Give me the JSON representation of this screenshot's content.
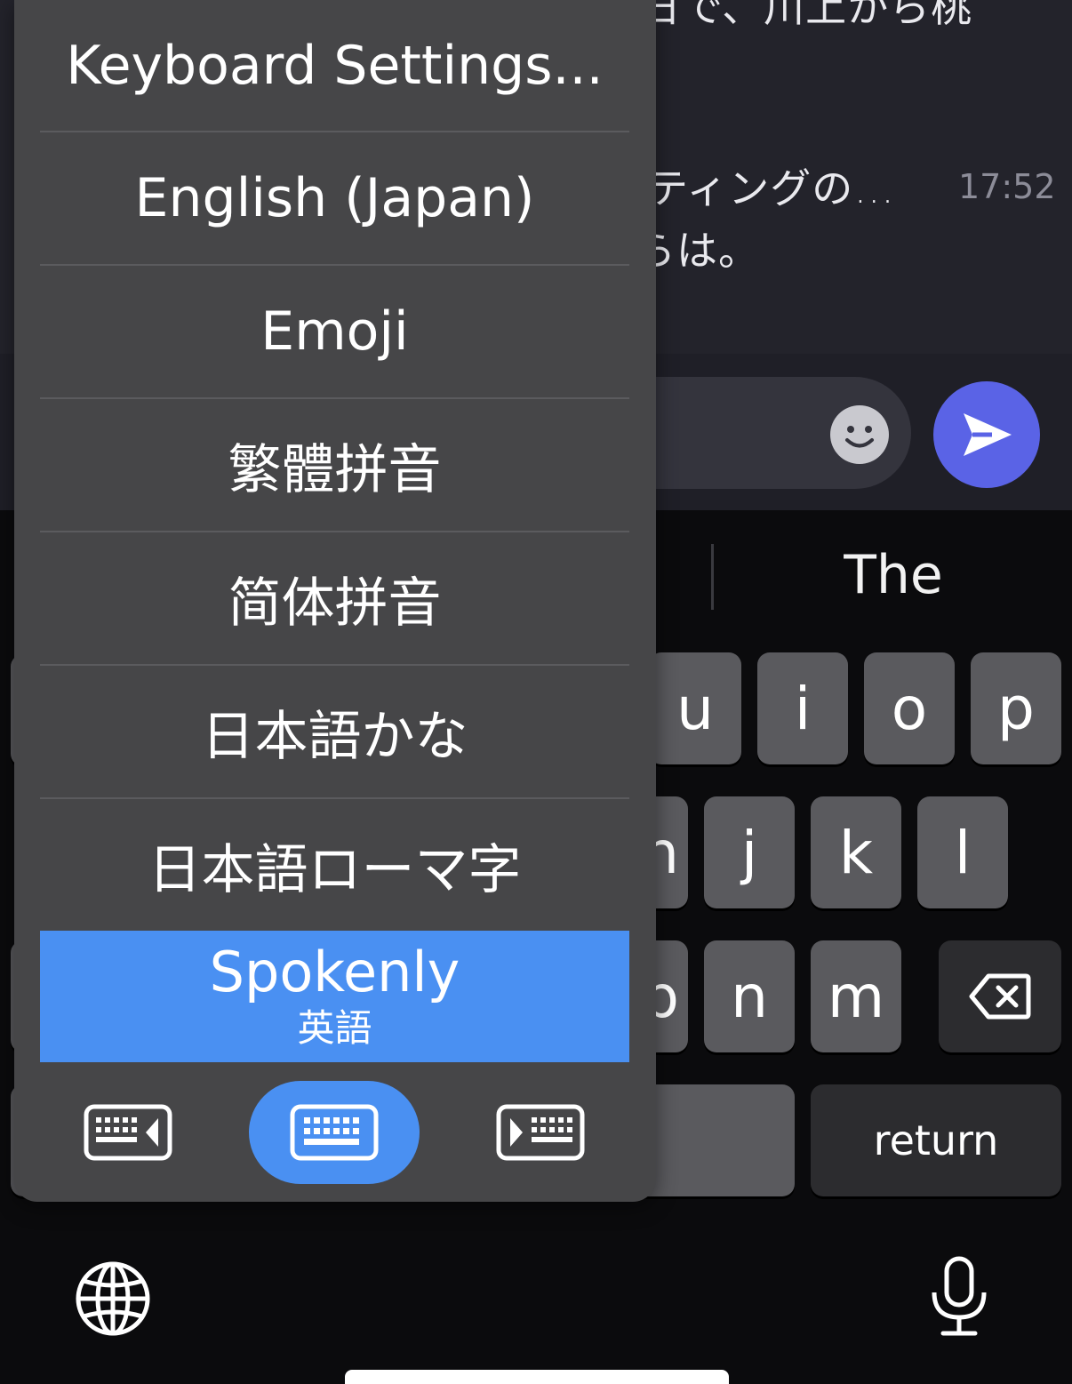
{
  "chat": {
    "line1": "日で、川上から桃",
    "line2": "ティングの…",
    "line3": "らは。",
    "timestamp": "17:52"
  },
  "keyboard": {
    "suggestion": "The",
    "row1": [
      "u",
      "i",
      "o",
      "p"
    ],
    "row2": [
      "n",
      "j",
      "k",
      "l"
    ],
    "row3": [
      "b",
      "n",
      "m"
    ],
    "return_label": "return"
  },
  "language_menu": {
    "items": [
      "Keyboard Settings...",
      "English (Japan)",
      "Emoji",
      "繁體拼音",
      "简体拼音",
      "日本語かな",
      "日本語ローマ字"
    ],
    "selected": {
      "name": "Spokenly",
      "subtitle": "英語"
    },
    "accent_color": "#4a90f2"
  },
  "icons": [
    "smiley-icon",
    "send-arrow-icon",
    "backspace-icon",
    "globe-icon",
    "microphone-icon",
    "keyboard-left-icon",
    "keyboard-center-icon",
    "keyboard-right-icon"
  ]
}
